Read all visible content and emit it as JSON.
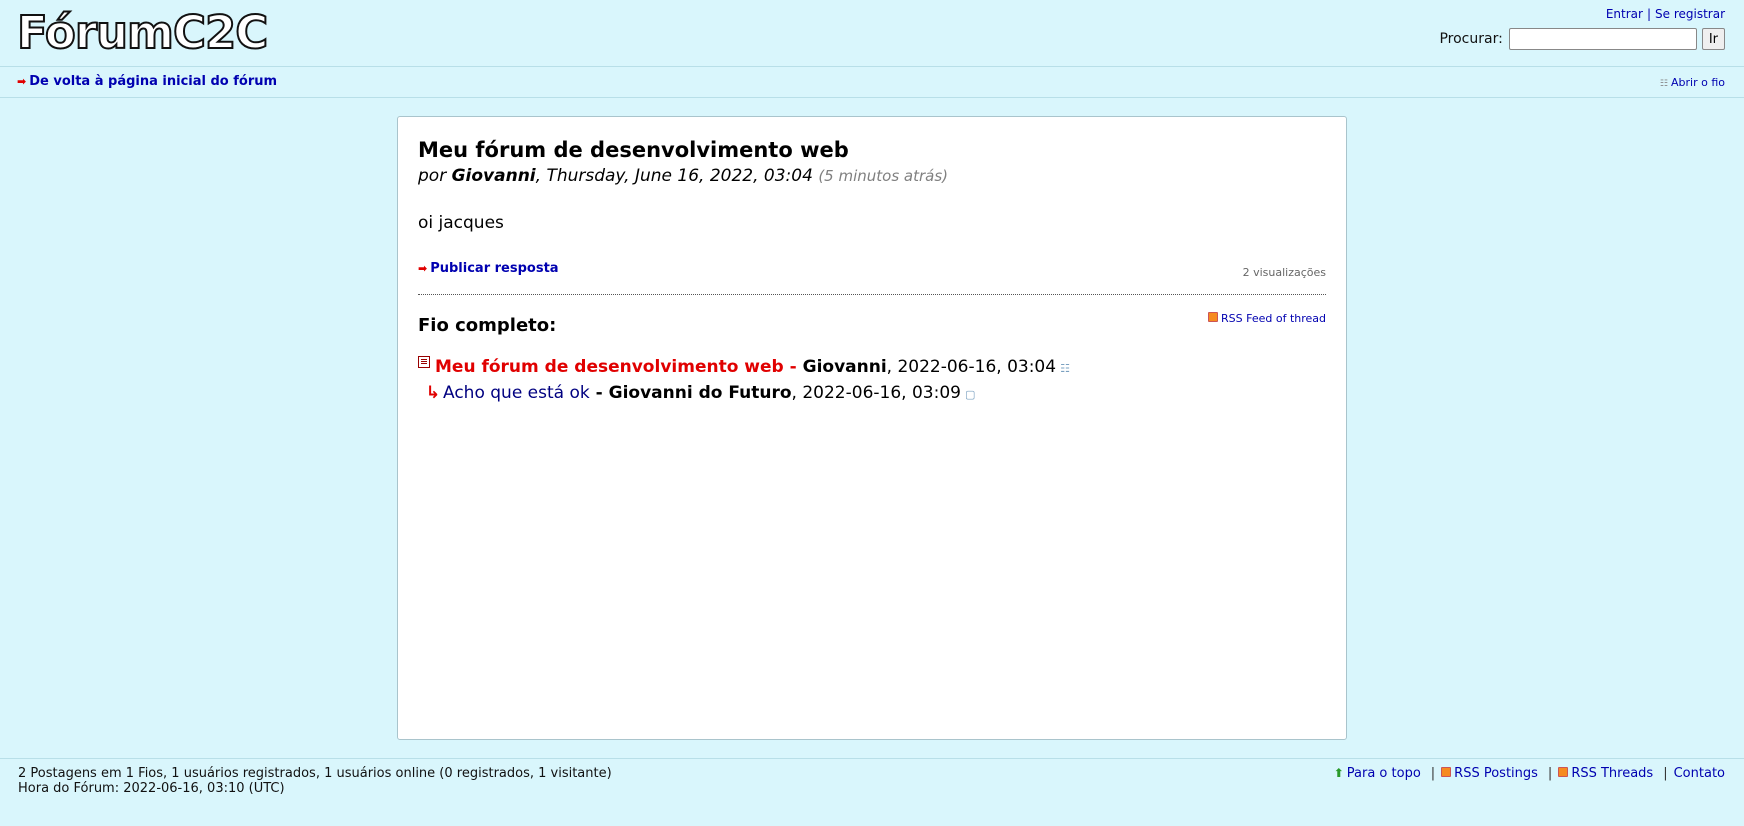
{
  "header": {
    "logo_text": "FórumC2C",
    "login_label": "Entrar",
    "separator": "|",
    "register_label": "Se registrar",
    "search_label": "Procurar:",
    "search_value": "",
    "search_button": "Ir"
  },
  "nav": {
    "back_label": "De volta à página inicial do fórum",
    "open_thread_label": "Abrir o fio"
  },
  "post": {
    "title": "Meu fórum de desenvolvimento web",
    "by": "por",
    "author": "Giovanni",
    "date": ", Thursday, June 16, 2022, 03:04",
    "ago": "(5 minutos atrás)",
    "body": "oi jacques",
    "reply_label": "Publicar resposta",
    "views": "2 visualizações"
  },
  "thread": {
    "heading": "Fio completo:",
    "rss_label": "RSS Feed of thread",
    "items": [
      {
        "title": "Meu fórum de desenvolvimento web",
        "dash": " - ",
        "author": "Giovanni",
        "date": ", 2022-06-16, 03:04"
      },
      {
        "title": "Acho que está ok",
        "dash": " - ",
        "author": "Giovanni do Futuro",
        "date": ", 2022-06-16, 03:09"
      }
    ]
  },
  "footer": {
    "stats_line1": "2 Postagens em 1 Fios, 1 usuários registrados, 1 usuários online (0 registrados, 1 visitante)",
    "stats_line2": "Hora do Fórum: 2022-06-16, 03:10 (UTC)",
    "top_label": "Para o topo",
    "rss_postings": "RSS Postings",
    "rss_threads": "RSS Threads",
    "contact": "Contato",
    "sep": "|"
  },
  "colors": {
    "background": "#d9f6fc",
    "link": "#0000b0",
    "current": "#e00000"
  }
}
